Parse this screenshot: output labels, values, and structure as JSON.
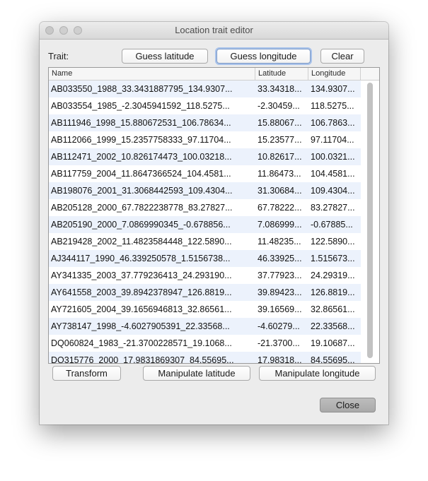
{
  "window": {
    "title": "Location trait editor"
  },
  "trait": {
    "label": "Trait:",
    "guess_latitude": "Guess latitude",
    "guess_longitude": "Guess longitude",
    "clear": "Clear"
  },
  "table": {
    "headers": {
      "name": "Name",
      "latitude": "Latitude",
      "longitude": "Longitude"
    },
    "rows": [
      {
        "name": "AB033550_1988_33.3431887795_134.9307...",
        "lat": "33.34318...",
        "lon": "134.9307..."
      },
      {
        "name": "AB033554_1985_-2.3045941592_118.5275...",
        "lat": "-2.30459...",
        "lon": "118.5275..."
      },
      {
        "name": "AB111946_1998_15.880672531_106.78634...",
        "lat": "15.88067...",
        "lon": "106.7863..."
      },
      {
        "name": "AB112066_1999_15.2357758333_97.11704...",
        "lat": "15.23577...",
        "lon": "97.11704..."
      },
      {
        "name": "AB112471_2002_10.826174473_100.03218...",
        "lat": "10.82617...",
        "lon": "100.0321..."
      },
      {
        "name": "AB117759_2004_11.8647366524_104.4581...",
        "lat": "11.86473...",
        "lon": "104.4581..."
      },
      {
        "name": "AB198076_2001_31.3068442593_109.4304...",
        "lat": "31.30684...",
        "lon": "109.4304..."
      },
      {
        "name": "AB205128_2000_67.7822238778_83.27827...",
        "lat": "67.78222...",
        "lon": "83.27827..."
      },
      {
        "name": "AB205190_2000_7.0869990345_-0.678856...",
        "lat": "7.086999...",
        "lon": "-0.67885..."
      },
      {
        "name": "AB219428_2002_11.4823584448_122.5890...",
        "lat": "11.48235...",
        "lon": "122.5890..."
      },
      {
        "name": "AJ344117_1990_46.339250578_1.5156738...",
        "lat": "46.33925...",
        "lon": "1.515673..."
      },
      {
        "name": "AY341335_2003_37.779236413_24.293190...",
        "lat": "37.77923...",
        "lon": "24.29319..."
      },
      {
        "name": "AY641558_2003_39.8942378947_126.8819...",
        "lat": "39.89423...",
        "lon": "126.8819..."
      },
      {
        "name": "AY721605_2004_39.1656946813_32.86561...",
        "lat": "39.16569...",
        "lon": "32.86561..."
      },
      {
        "name": "AY738147_1998_-4.6027905391_22.33568...",
        "lat": "-4.60279...",
        "lon": "22.33568..."
      },
      {
        "name": "DQ060824_1983_-21.3700228571_19.1068...",
        "lat": "-21.3700...",
        "lon": "19.10687..."
      },
      {
        "name": "DQ315776_2000_17.9831869307_84.55695...",
        "lat": "17.98318...",
        "lon": "84.55695..."
      }
    ]
  },
  "actions": {
    "transform": "Transform",
    "manipulate_latitude": "Manipulate latitude",
    "manipulate_longitude": "Manipulate longitude",
    "close": "Close"
  }
}
